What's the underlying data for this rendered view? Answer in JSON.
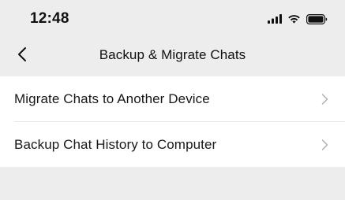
{
  "status_bar": {
    "time": "12:48",
    "icons": [
      "signal-icon",
      "wifi-icon",
      "battery-icon"
    ]
  },
  "nav": {
    "title": "Backup & Migrate Chats",
    "back_icon": "chevron-left-icon"
  },
  "menu": {
    "items": [
      {
        "label": "Migrate Chats to Another Device",
        "icon": "chevron-right-icon"
      },
      {
        "label": "Backup Chat History to Computer",
        "icon": "chevron-right-icon"
      }
    ]
  },
  "colors": {
    "background": "#ededed",
    "card": "#ffffff",
    "text": "#111111",
    "chevron": "#b2b2b2",
    "divider": "#e6e6e6"
  }
}
